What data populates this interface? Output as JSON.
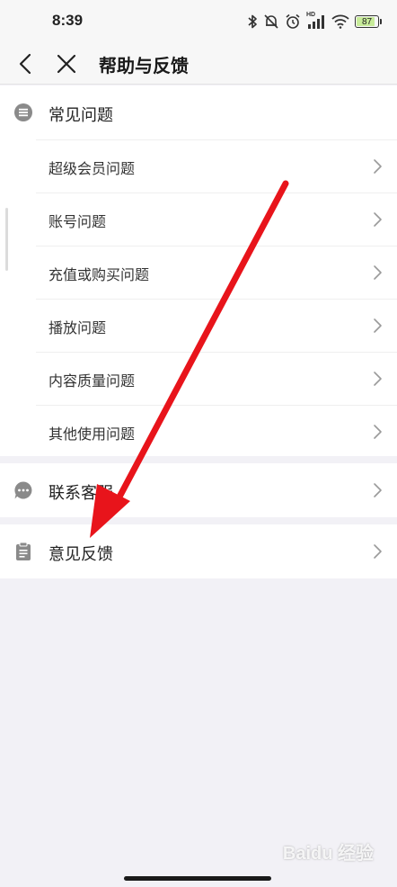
{
  "status_bar": {
    "time": "8:39",
    "signal_label": "HD",
    "battery": "87"
  },
  "nav": {
    "title": "帮助与反馈"
  },
  "faq": {
    "title": "常见问题",
    "items": [
      {
        "label": "超级会员问题"
      },
      {
        "label": "账号问题"
      },
      {
        "label": "充值或购买问题"
      },
      {
        "label": "播放问题"
      },
      {
        "label": "内容质量问题"
      },
      {
        "label": "其他使用问题"
      }
    ]
  },
  "contact": {
    "label": "联系客服"
  },
  "feedback": {
    "label": "意见反馈"
  },
  "watermark": {
    "text": "Baidu 经验"
  },
  "colors": {
    "background": "#f2f1f6",
    "card": "#ffffff",
    "annotation_arrow": "#e8141b",
    "icon_gray": "#8a8a8a"
  }
}
